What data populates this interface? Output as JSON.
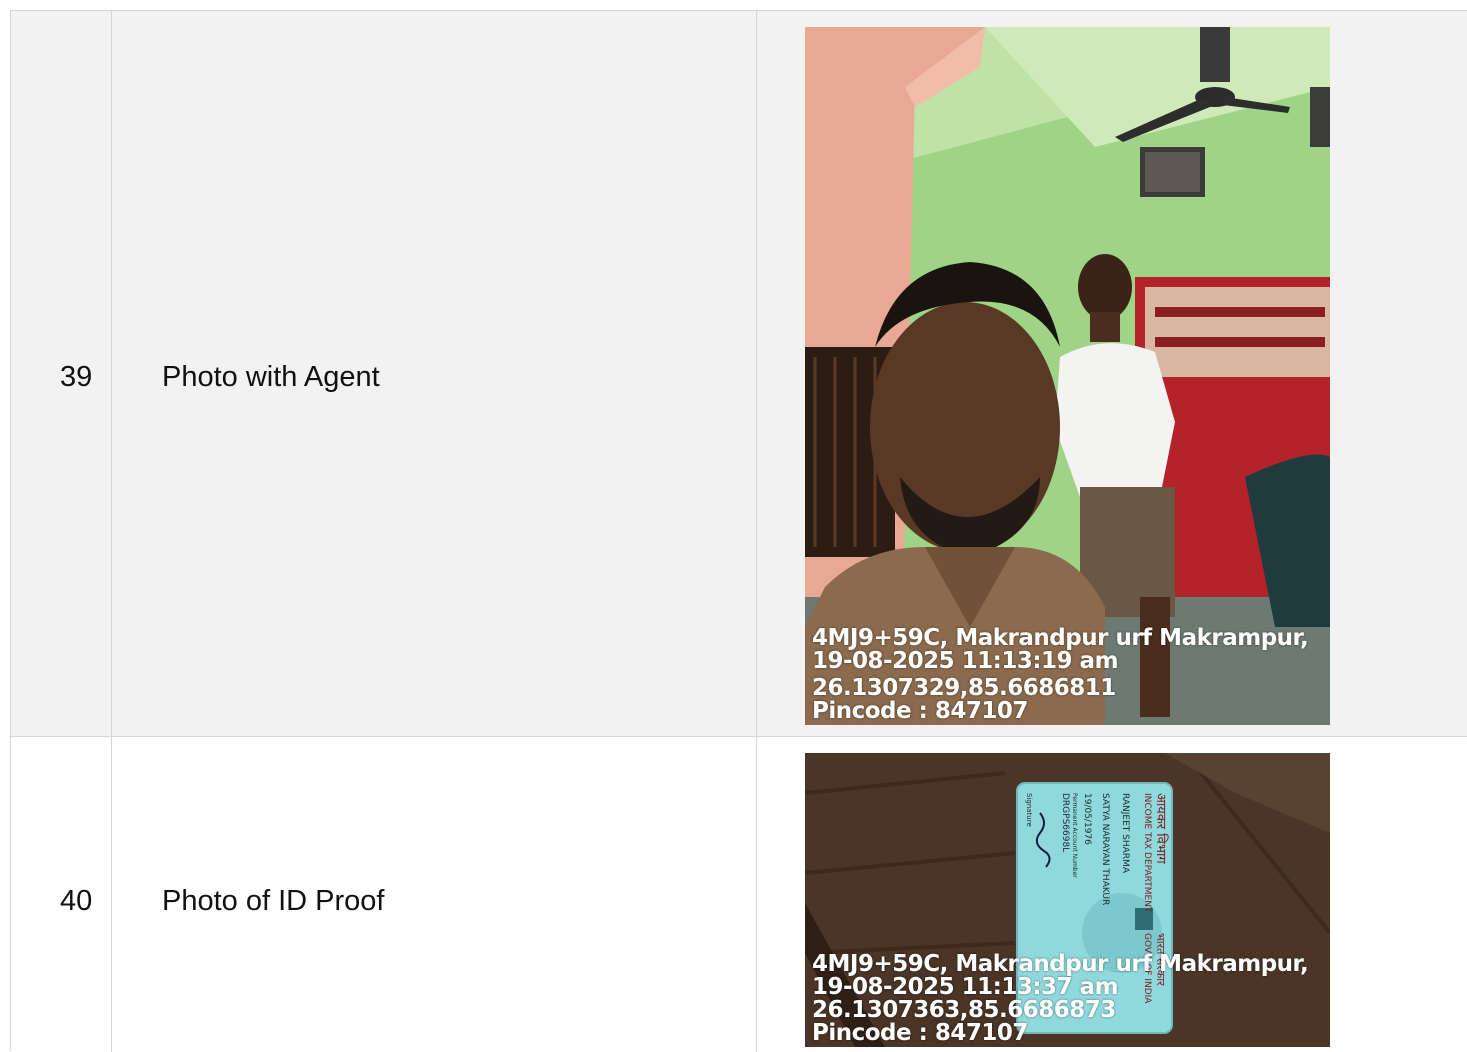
{
  "rows": [
    {
      "number": "39",
      "label": "Photo with Agent",
      "stamp": {
        "line1": "4MJ9+59C, Makrandpur urf Makrampur,",
        "line2": "19-08-2025 11:13:19 am",
        "line3": "26.1307329,85.6686811",
        "line4": "Pincode : 847107"
      }
    },
    {
      "number": "40",
      "label": "Photo of ID Proof",
      "stamp": {
        "line1": "4MJ9+59C, Makrandpur urf Makrampur,",
        "line2": "19-08-2025 11:13:37 am",
        "line3": "26.1307363,85.6686873",
        "line4": "Pincode : 847107"
      },
      "card": {
        "header_hindi": "आयकर विभाग",
        "header_english": "INCOME TAX DEPARTMENT",
        "gov_hindi": "भारत सरकार",
        "gov_english": "GOVT. OF INDIA",
        "name": "RANJEET SHARMA",
        "father_name": "SATYA NARAYAN THAKUR",
        "dob": "19/05/1976",
        "pan_label": "Permanent Account Number",
        "pan": "DRGPS6698L",
        "signature_label": "Signature"
      }
    }
  ],
  "colors": {
    "row_alt_bg": "#f2f2f2",
    "border": "#d6d6d6",
    "wall_green": "#9fd486",
    "pillar_pink": "#e8a894",
    "wood_brown": "#4a3526",
    "card_cyan": "#8fd8dc"
  }
}
